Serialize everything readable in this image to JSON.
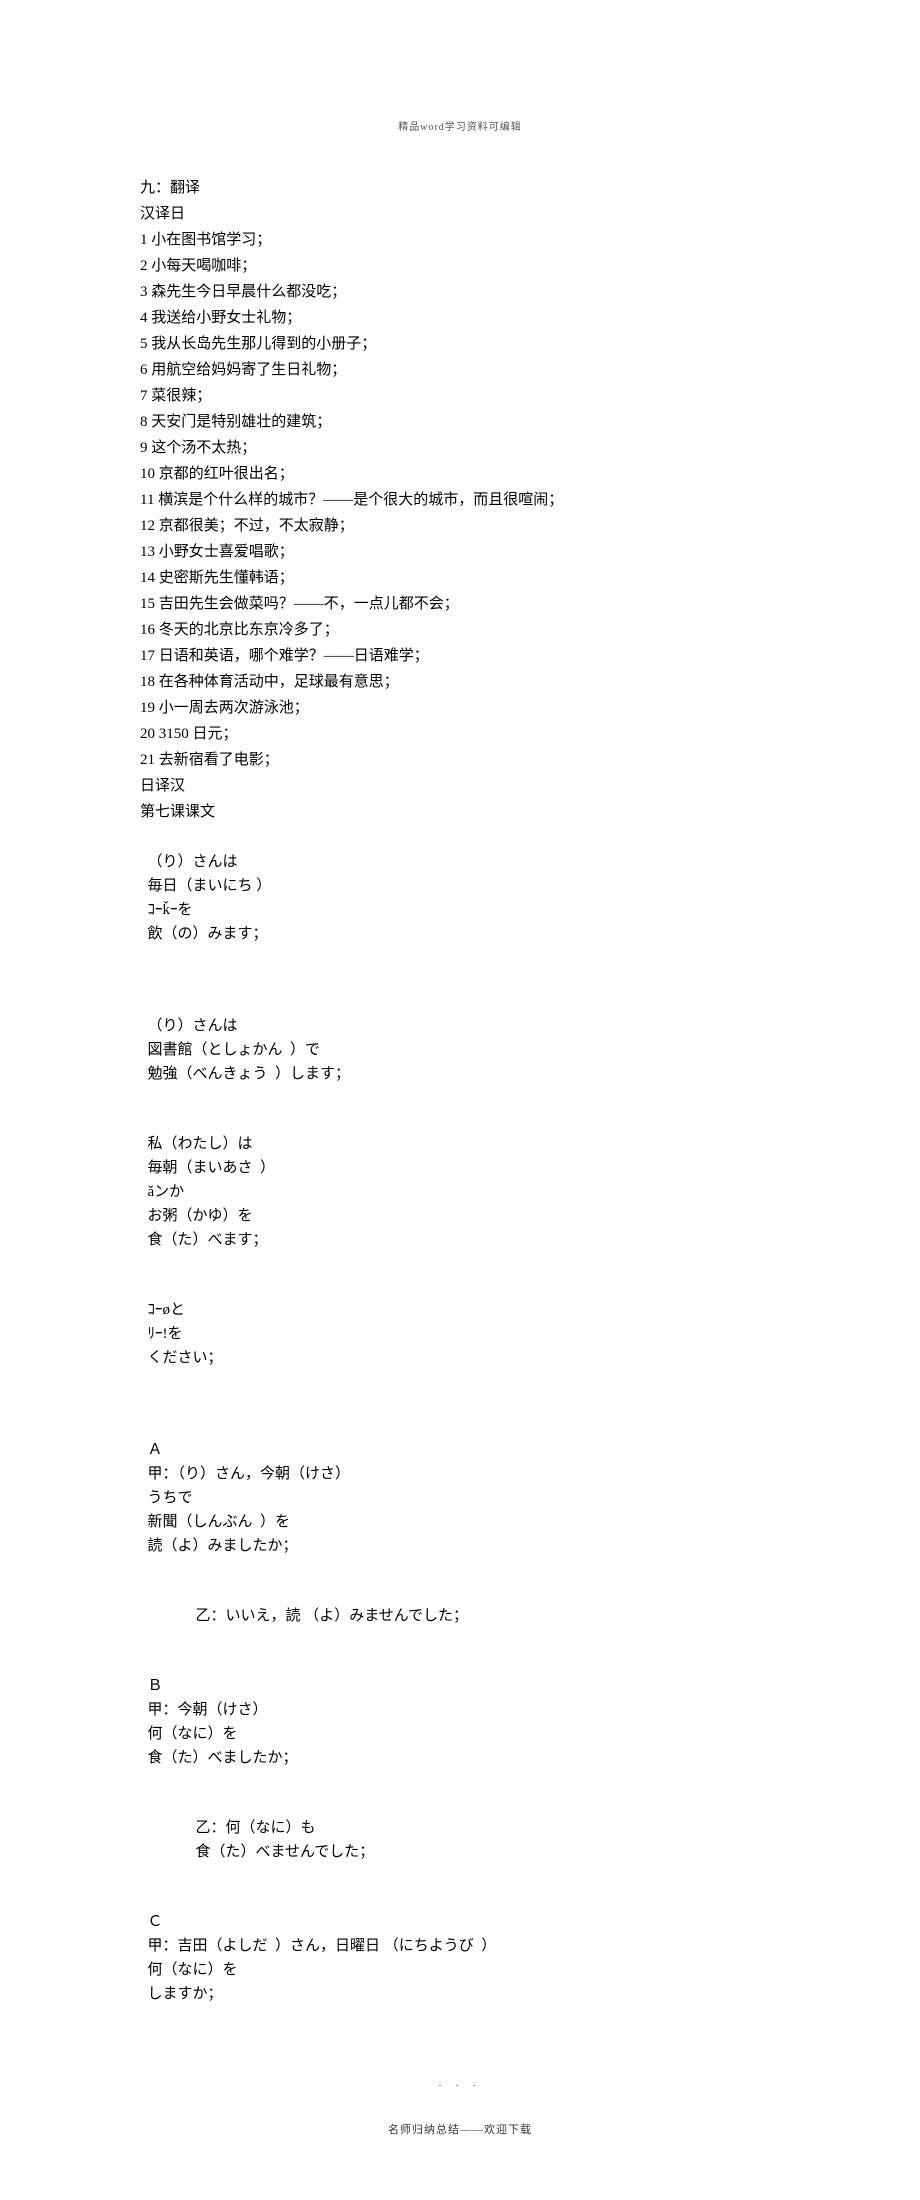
{
  "header_note": "精品word学习资料可编辑",
  "section_title": "九：翻译",
  "sub_cn_jp": "汉译日",
  "items": [
    "1 小在图书馆学习；",
    "2 小每天喝咖啡；",
    "3 森先生今日早晨什么都没吃；",
    "4 我送给小野女士礼物；",
    "5 我从长岛先生那儿得到的小册子；",
    "6 用航空给妈妈寄了生日礼物；",
    "7 菜很辣；",
    "8 天安门是特别雄壮的建筑；",
    "9 这个汤不太热；",
    "10 京都的红叶很出名；",
    "11 横滨是个什么样的城市？——是个很大的城市，而且很喧闹；",
    "12 京都很美；不过，不太寂静；",
    "13 小野女士喜爱唱歌；",
    "14 史密斯先生懂韩语；",
    "15 吉田先生会做菜吗？——不，一点儿都不会；",
    "16 冬天的北京比东京冷多了；",
    "17 日语和英语，哪个难学？——日语难学；",
    "18 在各种体育活动中，足球最有意思；",
    "19 小一周去两次游泳池；",
    "20 3150 日元；",
    "21 去新宿看了电影；"
  ],
  "sub_jp_cn": "日译汉",
  "lesson7": "第七课课文",
  "jp1_a": "（り）さんは",
  "jp1_b": "毎日（まいにち ）",
  "jp1_c": "ｺｰǩｰを",
  "jp1_d": "飲（の）みます；",
  "jp2_a": "（り）さんは",
  "jp2_b": "図書館（としょかん  ）で",
  "jp2_c": "勉強（べんきょう  ）します；",
  "jp3_a": "私（わたし）は",
  "jp3_b": "毎朝（まいあさ  ）",
  "jp3_c": "ǎンか",
  "jp3_d": "お粥（かゆ）を",
  "jp3_e": "食（た）べます；",
  "jp4_a": "ｺｰøと",
  "jp4_b": "ﾘｰ!を",
  "jp4_c": "ください；",
  "dlgA_k_a": "Ａ",
  "dlgA_k_b": "甲：（り）さん，今朝（けさ）",
  "dlgA_k_c": "うちで",
  "dlgA_k_d": "新聞（しんぶん  ）を",
  "dlgA_k_e": "読（よ）みましたか；",
  "dlgA_o_a": "乙：いいえ，読 （よ）みませんでした；",
  "dlgB_k_a": "Ｂ",
  "dlgB_k_b": "甲：今朝（けさ）",
  "dlgB_k_c": "何（なに）を",
  "dlgB_k_d": "食（た）べましたか；",
  "dlgB_o_a": "乙：何（なに）も",
  "dlgB_o_b": "食（た）べませんでした；",
  "dlgC_k_a": "Ｃ",
  "dlgC_k_b": "甲：吉田（よしだ  ）さん，日曜日 （にちようび  ）",
  "dlgC_k_c": "何（なに）を",
  "dlgC_k_d": "しますか；",
  "footer_dots": ".   .   .",
  "footer_text": "名师归纳总结——欢迎下载"
}
